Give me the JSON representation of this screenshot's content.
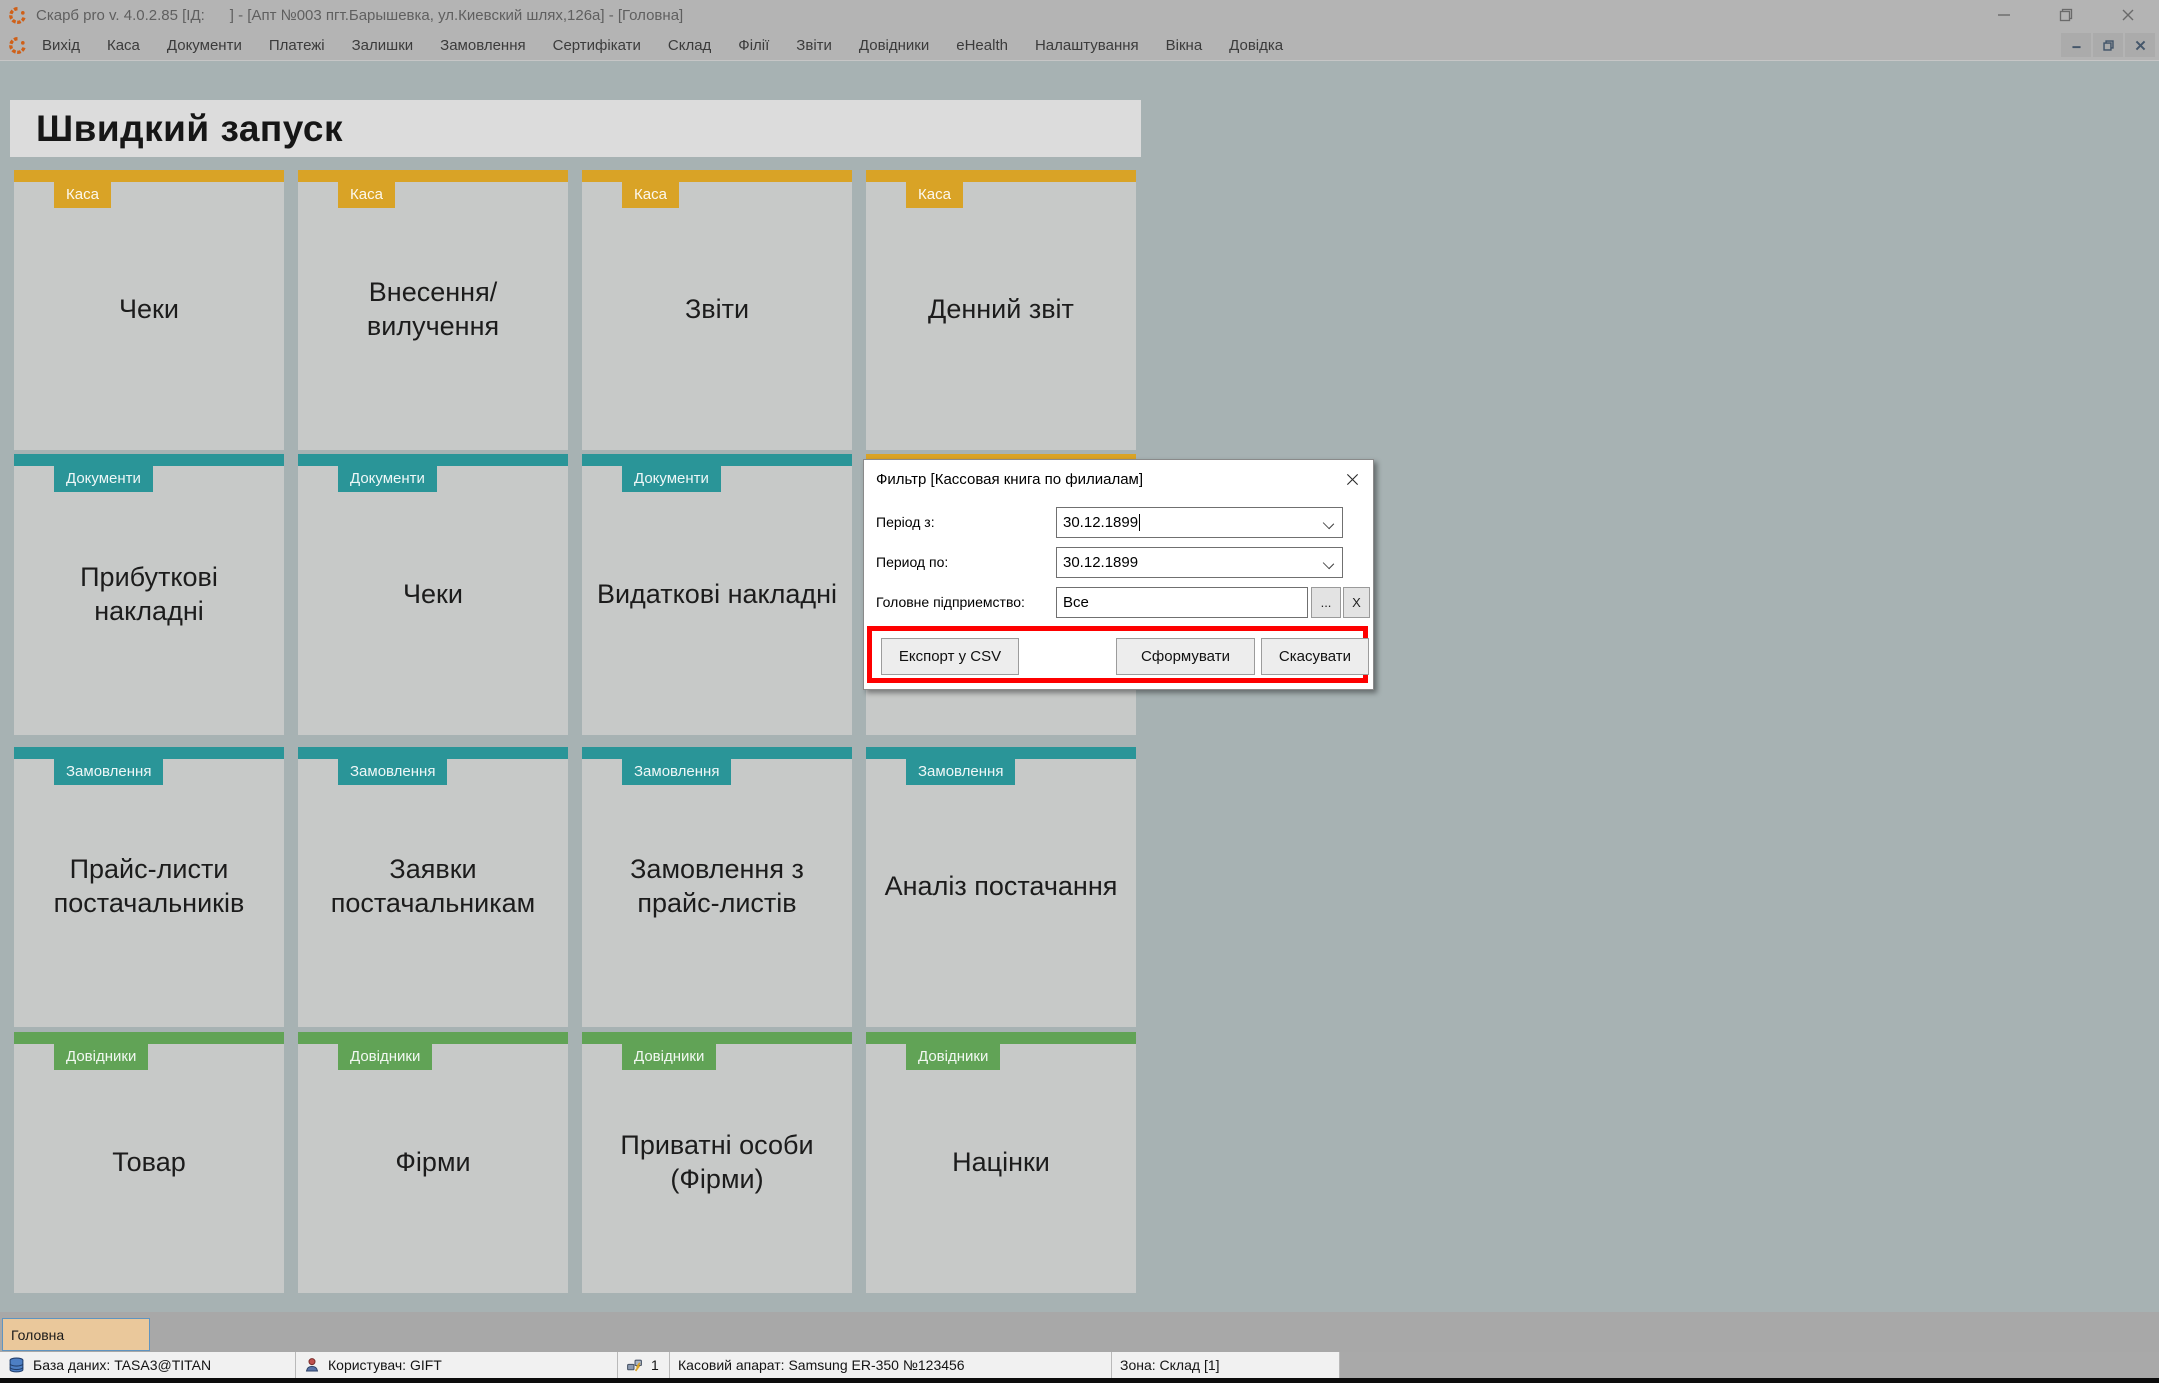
{
  "colors": {
    "kasa": "#d9a326",
    "teal": "#2a9598",
    "green": "#61a356",
    "highlight": "#fe0000",
    "tab_bg": "#eac89b",
    "chrome_bg": "#b4b4b4",
    "content_bg": "#a7b2b3",
    "tile_bg": "#c7c9c8"
  },
  "window": {
    "title": "Скарб pro v. 4.0.2.85 [ІД:      ] - [Апт №003 пгт.Барышевка, ул.Киевский шлях,126а] - [Головна]"
  },
  "menubar": {
    "items": [
      "Вихід",
      "Каса",
      "Документи",
      "Платежі",
      "Залишки",
      "Замовлення",
      "Сертифікати",
      "Склад",
      "Філії",
      "Звіти",
      "Довідники",
      "eHealth",
      "Налаштування",
      "Вікна",
      "Довідка"
    ]
  },
  "quick_launch": {
    "title": "Швидкий запуск",
    "rows": [
      {
        "tiles": [
          {
            "category": "Каса",
            "label": "Чеки"
          },
          {
            "category": "Каса",
            "label": "Внесення/вилучення"
          },
          {
            "category": "Каса",
            "label": "Звіти"
          },
          {
            "category": "Каса",
            "label": "Денний звіт"
          }
        ]
      },
      {
        "tiles": [
          {
            "category": "Документи",
            "label": "Прибуткові накладні"
          },
          {
            "category": "Документи",
            "label": "Чеки"
          },
          {
            "category": "Документи",
            "label": "Видаткові накладні"
          },
          {
            "category": "",
            "label": ""
          }
        ]
      },
      {
        "tiles": [
          {
            "category": "Замовлення",
            "label": "Прайс-листи постачальників"
          },
          {
            "category": "Замовлення",
            "label": "Заявки постачальникам"
          },
          {
            "category": "Замовлення",
            "label": "Замовлення з прайс-листів"
          },
          {
            "category": "Замовлення",
            "label": "Аналіз постачання"
          }
        ]
      },
      {
        "tiles": [
          {
            "category": "Довідники",
            "label": "Товар"
          },
          {
            "category": "Довідники",
            "label": "Фірми"
          },
          {
            "category": "Довідники",
            "label": "Приватні особи (Фірми)"
          },
          {
            "category": "Довідники",
            "label": "Націнки"
          }
        ]
      }
    ]
  },
  "dialog": {
    "title": "Фильтр [Кассовая книга по филиалам]",
    "fields": [
      {
        "label": "Період з:",
        "value": "30.12.1899"
      },
      {
        "label": "Период по:",
        "value": "30.12.1899"
      },
      {
        "label": "Головне підприемство:",
        "value": "Все",
        "browse_label": "...",
        "clear_label": "X"
      }
    ],
    "buttons": {
      "export": "Експорт у CSV",
      "submit": "Сформувати",
      "cancel": "Скасувати"
    }
  },
  "taskbar": {
    "active_tab": "Головна"
  },
  "statusbar": {
    "items": [
      {
        "icon": "database-icon",
        "text": "База даних: TASA3@TITAN"
      },
      {
        "icon": "user-icon",
        "text": "Користувач: GIFT"
      },
      {
        "icon": "connection-icon",
        "text": "1"
      },
      {
        "icon": "",
        "text": "Касовий апарат: Samsung ER-350 №123456"
      },
      {
        "icon": "",
        "text": "Зона: Склад [1]"
      }
    ]
  }
}
